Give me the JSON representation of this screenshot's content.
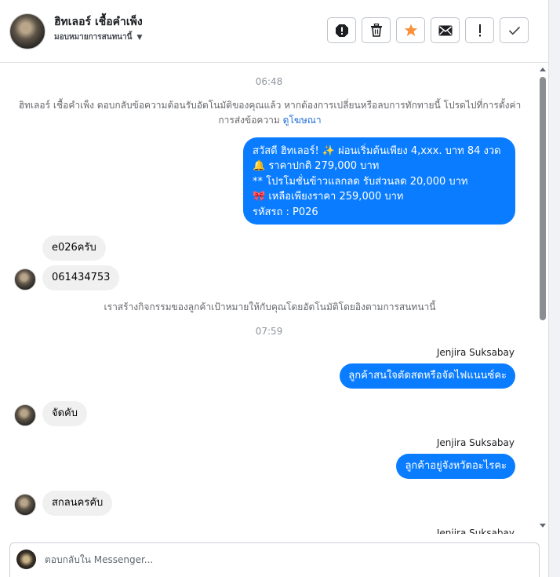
{
  "header": {
    "contact_name": "ฮิทเลอร์ เชื้อคำเพ็ง",
    "assign_label": "มอบหมายการสนทนานี้",
    "actions": [
      {
        "icon": "spam-alert-icon"
      },
      {
        "icon": "trash-icon"
      },
      {
        "icon": "star-icon",
        "color": "#f7923b"
      },
      {
        "icon": "mail-icon"
      },
      {
        "icon": "exclamation-icon"
      },
      {
        "icon": "check-icon"
      }
    ]
  },
  "chat": {
    "time1": "06:48",
    "system1_text": "ฮิทเลอร์ เชื้อคำเพ็ง ตอบกลับข้อความต้อนรับอัตโนมัติของคุณแล้ว หากต้องการเปลี่ยนหรือลบการทักทายนี้ โปรดไปที่การตั้งค่าการส่งข้อความ",
    "system1_link": "ดูโฆษณา",
    "outgoing_promo": {
      "line1": "สวัสดี ฮิทเลอร์! ✨  ผ่อนเริ่มต้นเพียง 4,xxx. บาท 84 งวด",
      "line2": "🔔 ราคาปกติ 279,000 บาท",
      "line3": "** โปรโมชั่นข้าวแลกลด รับส่วนลด 20,000 บาท",
      "line4": "🎀  เหลือเพียงราคา 259,000 บาท",
      "line5": " รหัสรถ : P026"
    },
    "incoming1": "e026ครับ",
    "incoming2": "061434753",
    "system2_text": "เราสร้างกิจกรรมของลูกค้าเป้าหมายให้กับคุณโดยอัตโนมัติโดยอิงตามการสนทนานี้",
    "time2": "07:59",
    "sender1": "Jenjira Suksabay",
    "outgoing2": "ลูกค้าสนใจตัดสดหรือจัดไฟแนนซ์คะ",
    "incoming3": "จัดคับ",
    "sender2": "Jenjira Suksabay",
    "outgoing3": "ลูกค้าอยู่จังหวัดอะไรคะ",
    "incoming4": "สกลนครคับ",
    "sender3": "Jenjira Suksabay"
  },
  "composer": {
    "placeholder": "ตอบกลับใน Messenger..."
  },
  "colors": {
    "outgoing_bubble": "#0a7cff",
    "incoming_bubble": "#f0f0f0",
    "link": "#216fdb"
  }
}
